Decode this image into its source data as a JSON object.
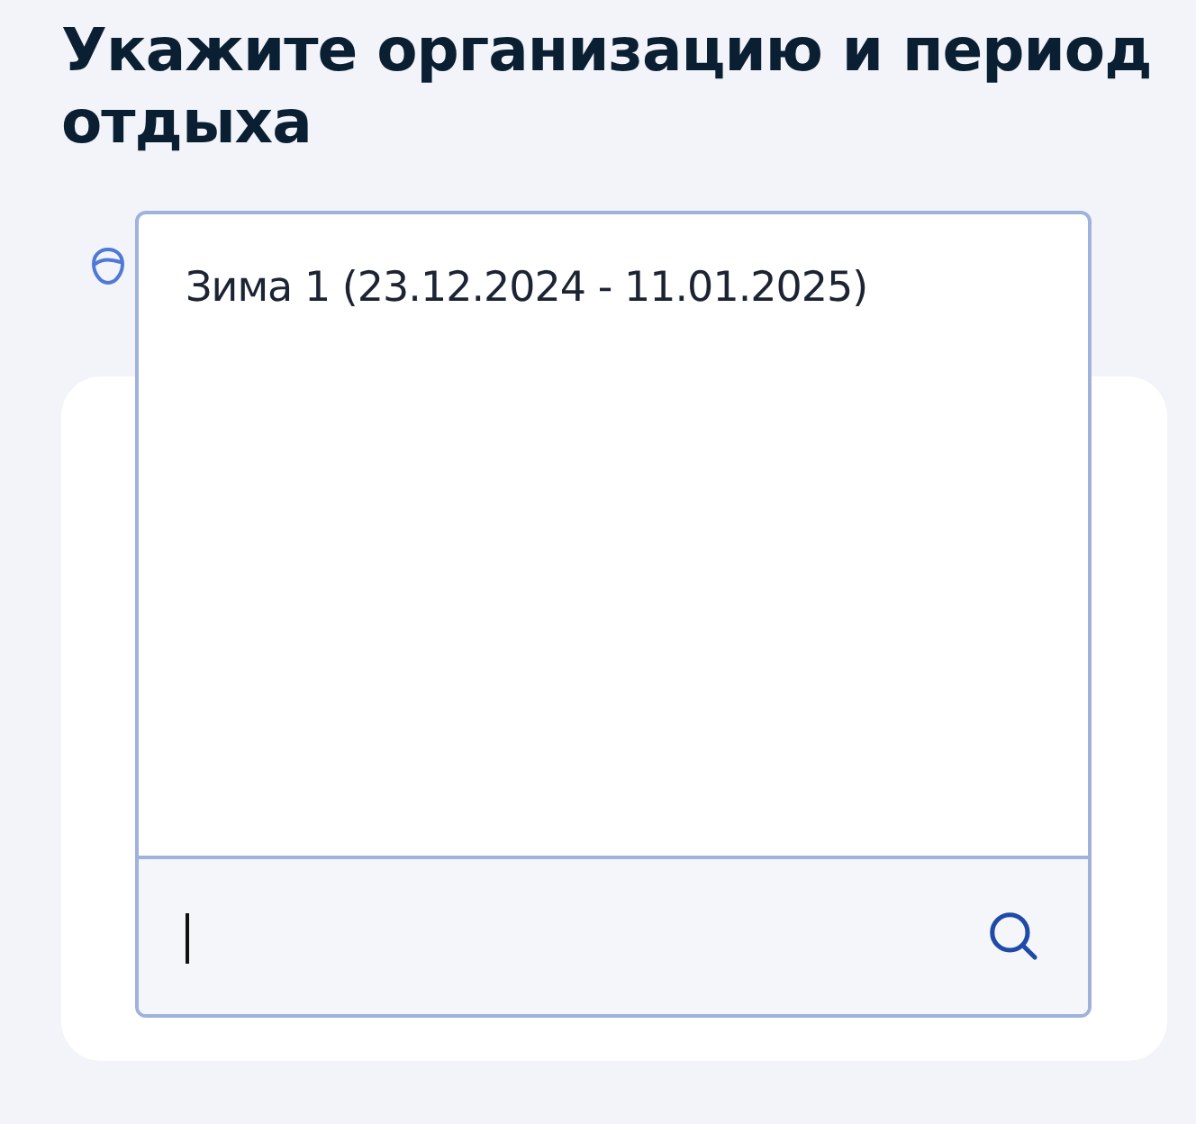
{
  "title": "Укажите организацию и период отдыха",
  "dropdown": {
    "options": [
      {
        "label": "Зима 1 (23.12.2024 - 11.01.2025)",
        "selected": false
      }
    ]
  }
}
